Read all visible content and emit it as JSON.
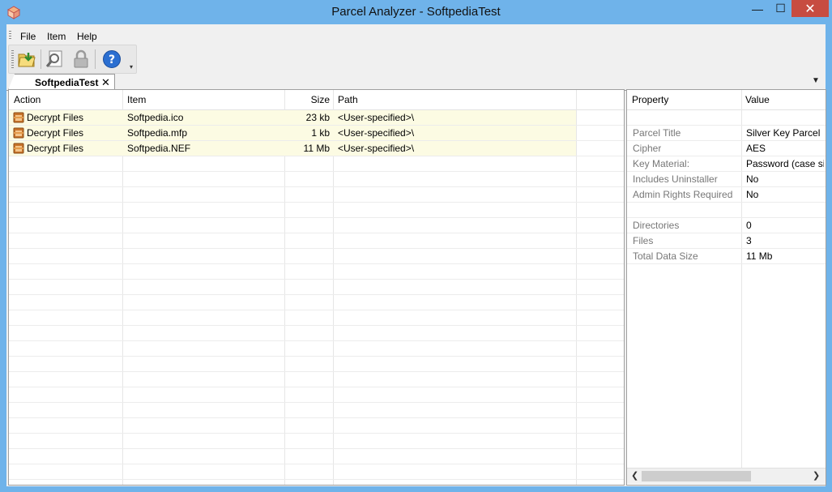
{
  "window": {
    "title": "Parcel Analyzer - SoftpediaTest",
    "minimize": "—",
    "maximize": "☐",
    "close": "✕"
  },
  "menu": [
    "File",
    "Item",
    "Help"
  ],
  "toolbar": {
    "buttons": [
      "open-parcel-icon",
      "analyze-icon",
      "lock-icon",
      "help-icon"
    ]
  },
  "tab": {
    "label": "SoftpediaTest",
    "close": "✕"
  },
  "items_table": {
    "columns": [
      "Action",
      "Item",
      "Size",
      "Path"
    ],
    "rows": [
      {
        "action": "Decrypt Files",
        "item": "Softpedia.ico",
        "size": "23 kb",
        "path": "<User-specified>\\"
      },
      {
        "action": "Decrypt Files",
        "item": "Softpedia.mfp",
        "size": "1 kb",
        "path": "<User-specified>\\"
      },
      {
        "action": "Decrypt Files",
        "item": "Softpedia.NEF",
        "size": "11 Mb",
        "path": "<User-specified>\\"
      }
    ]
  },
  "properties": {
    "columns": [
      "Property",
      "Value"
    ],
    "rows": [
      {
        "property": "",
        "value": ""
      },
      {
        "property": "Parcel Title",
        "value": "Silver Key Parcel"
      },
      {
        "property": "Cipher",
        "value": "AES"
      },
      {
        "property": "Key Material:",
        "value": "Password (case sig"
      },
      {
        "property": "Includes Uninstaller",
        "value": "No"
      },
      {
        "property": "Admin Rights Required",
        "value": "No"
      },
      {
        "property": "",
        "value": ""
      },
      {
        "property": "Directories",
        "value": "0"
      },
      {
        "property": "Files",
        "value": "3"
      },
      {
        "property": "Total Data Size",
        "value": "11 Mb"
      }
    ]
  },
  "colors": {
    "frame": "#6fb3ea",
    "close_button": "#c74c41",
    "row_highlight": "#fcfbe3"
  }
}
